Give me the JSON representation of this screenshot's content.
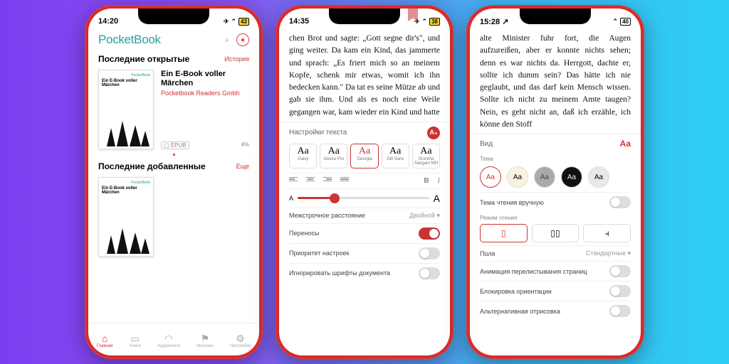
{
  "phone1": {
    "status": {
      "time": "14:20",
      "airplane": "✈︎",
      "wifi": "⌃",
      "battery": "43"
    },
    "logo": "PocketBook",
    "section1": {
      "title": "Последние открытые",
      "link": "История"
    },
    "book": {
      "cover_brand": "PocketBook",
      "cover_title": "Ein E-Book voller Märchen",
      "title": "Ein E-Book voller Märchen",
      "publisher": "Pocketbook Readers Gmbh",
      "format": "EPUB",
      "progress": "4%"
    },
    "section2": {
      "title": "Последние добавленные",
      "link": "Еще"
    },
    "tabs": [
      {
        "icon": "⌂",
        "label": "Главная"
      },
      {
        "icon": "▭",
        "label": "Книги"
      },
      {
        "icon": "◠",
        "label": "Аудиокниги"
      },
      {
        "icon": "⚑",
        "label": "Магазин"
      },
      {
        "icon": "⚙",
        "label": "Настройки"
      }
    ]
  },
  "phone2": {
    "status": {
      "time": "14:35",
      "airplane": "✈︎",
      "wifi": "⌃",
      "battery": "38"
    },
    "text": "chen Brot und sagte: „Gott segne dir's\", und ging weiter. Da kam ein Kind, das jammerte und sprach: „Es friert mich so an meinem Kopfe, schenk mir etwas, womit ich ihn bedecken kann.\" Da tat es seine Mütze ab und gab sie ihm. Und als es noch eine Weile gegangen war, kam wieder ein Kind und hatte",
    "panel_title": "Настройки текста",
    "fonts": [
      {
        "aa": "Aa",
        "name": "Galvji"
      },
      {
        "aa": "Aa",
        "name": "Geeza Pro"
      },
      {
        "aa": "Aa",
        "name": "Georgia"
      },
      {
        "aa": "Aa",
        "name": "Gill Sans"
      },
      {
        "aa": "Aa",
        "name": "Grantha Sangam MN"
      }
    ],
    "bold": "B",
    "italic": "I",
    "small_a": "A",
    "big_a": "A",
    "rows": {
      "line_spacing": "Межстрочное расстояние",
      "line_spacing_val": "Двойной ▾",
      "hyphens": "Переносы",
      "priority": "Приоритет настроек",
      "ignore_fonts": "Игнорировать шрифты документа"
    }
  },
  "phone3": {
    "status": {
      "time": "15:28",
      "loc": "↗",
      "wifi": "⌃",
      "battery": "40"
    },
    "text": "alte Minister fuhr fort, die Augen aufzureißen, aber er konnte nichts sehen; denn es war nichts da. Herrgott, dachte er, sollte ich dumm sein? Das hätte ich nie geglaubt, und das darf kein Mensch wissen. Sollte ich nicht zu meinem Amte taugen? Nein, es geht nicht an, daß ich erzähle, ich könne den Stoff",
    "panel_title": "Вид",
    "aa_icon": "Aa",
    "theme_label": "Тема",
    "themes": [
      "Aa",
      "Aa",
      "Aa",
      "Aa",
      "Aa"
    ],
    "manual_theme": "Тема чтения вручную",
    "reading_mode": "Режим чтения",
    "margins": "Поля",
    "margins_val": "Стандартные ▾",
    "anim": "Анимация перелистывания страниц",
    "lock": "Блокировка ориентации",
    "alt_render": "Альтернативная отрисовка"
  }
}
